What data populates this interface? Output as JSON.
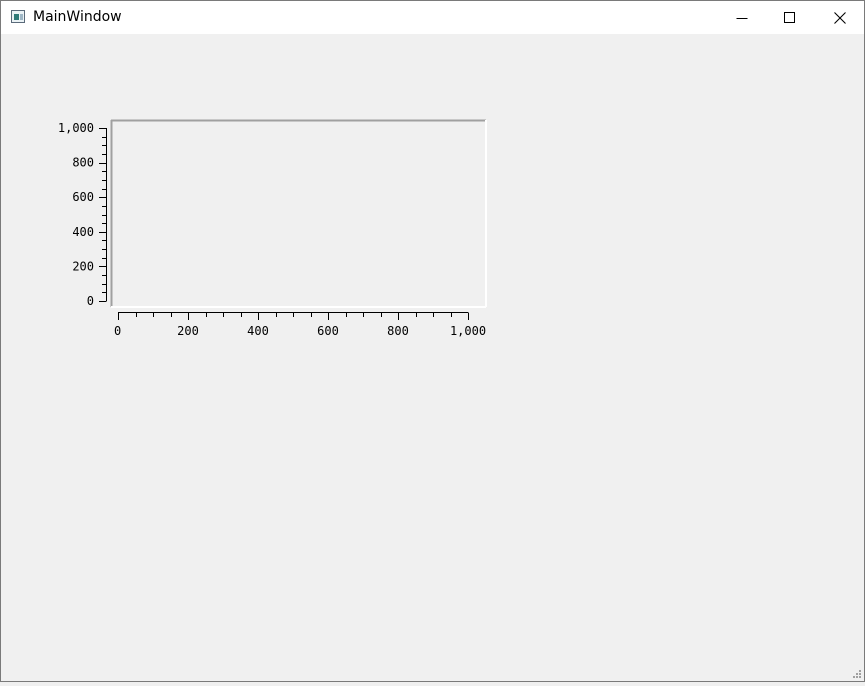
{
  "window": {
    "title": "MainWindow",
    "icon": "app-window-icon",
    "controls": {
      "minimize": "minimize-icon",
      "maximize": "maximize-icon",
      "close": "close-icon"
    }
  },
  "chart_data": {
    "type": "line",
    "series": [],
    "xlim": [
      0,
      1050
    ],
    "ylim": [
      0,
      1040
    ],
    "x_ticks": [
      "0",
      "200",
      "400",
      "600",
      "800",
      "1,000"
    ],
    "y_ticks": [
      "0",
      "200",
      "400",
      "600",
      "800",
      "1,000"
    ],
    "grid": false
  }
}
